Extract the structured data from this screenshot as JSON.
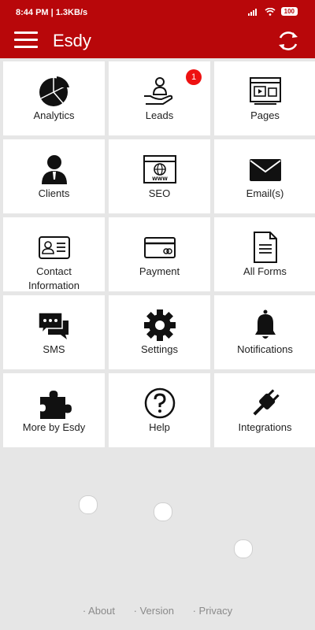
{
  "status": {
    "time_speed": "8:44 PM | 1.3KB/s",
    "battery": "100"
  },
  "appbar": {
    "title": "Esdy"
  },
  "tiles": [
    {
      "label": "Analytics",
      "icon": "pie-chart-icon"
    },
    {
      "label": "Leads",
      "icon": "hand-person-icon",
      "badge": "1"
    },
    {
      "label": "Pages",
      "icon": "web-page-icon"
    },
    {
      "label": "Clients",
      "icon": "client-person-icon"
    },
    {
      "label": "SEO",
      "icon": "www-browser-icon"
    },
    {
      "label": "Email(s)",
      "icon": "envelope-icon"
    },
    {
      "label": "Contact Information",
      "icon": "id-card-icon"
    },
    {
      "label": "Payment",
      "icon": "credit-card-icon"
    },
    {
      "label": "All Forms",
      "icon": "document-icon"
    },
    {
      "label": "SMS",
      "icon": "chat-bubbles-icon"
    },
    {
      "label": "Settings",
      "icon": "gear-icon"
    },
    {
      "label": "Notifications",
      "icon": "bell-icon"
    },
    {
      "label": "More by Esdy",
      "icon": "puzzle-icon"
    },
    {
      "label": "Help",
      "icon": "question-circle-icon"
    },
    {
      "label": "Integrations",
      "icon": "plug-icon"
    }
  ],
  "footer": {
    "about": "· About",
    "version": "· Version",
    "privacy": "· Privacy"
  }
}
